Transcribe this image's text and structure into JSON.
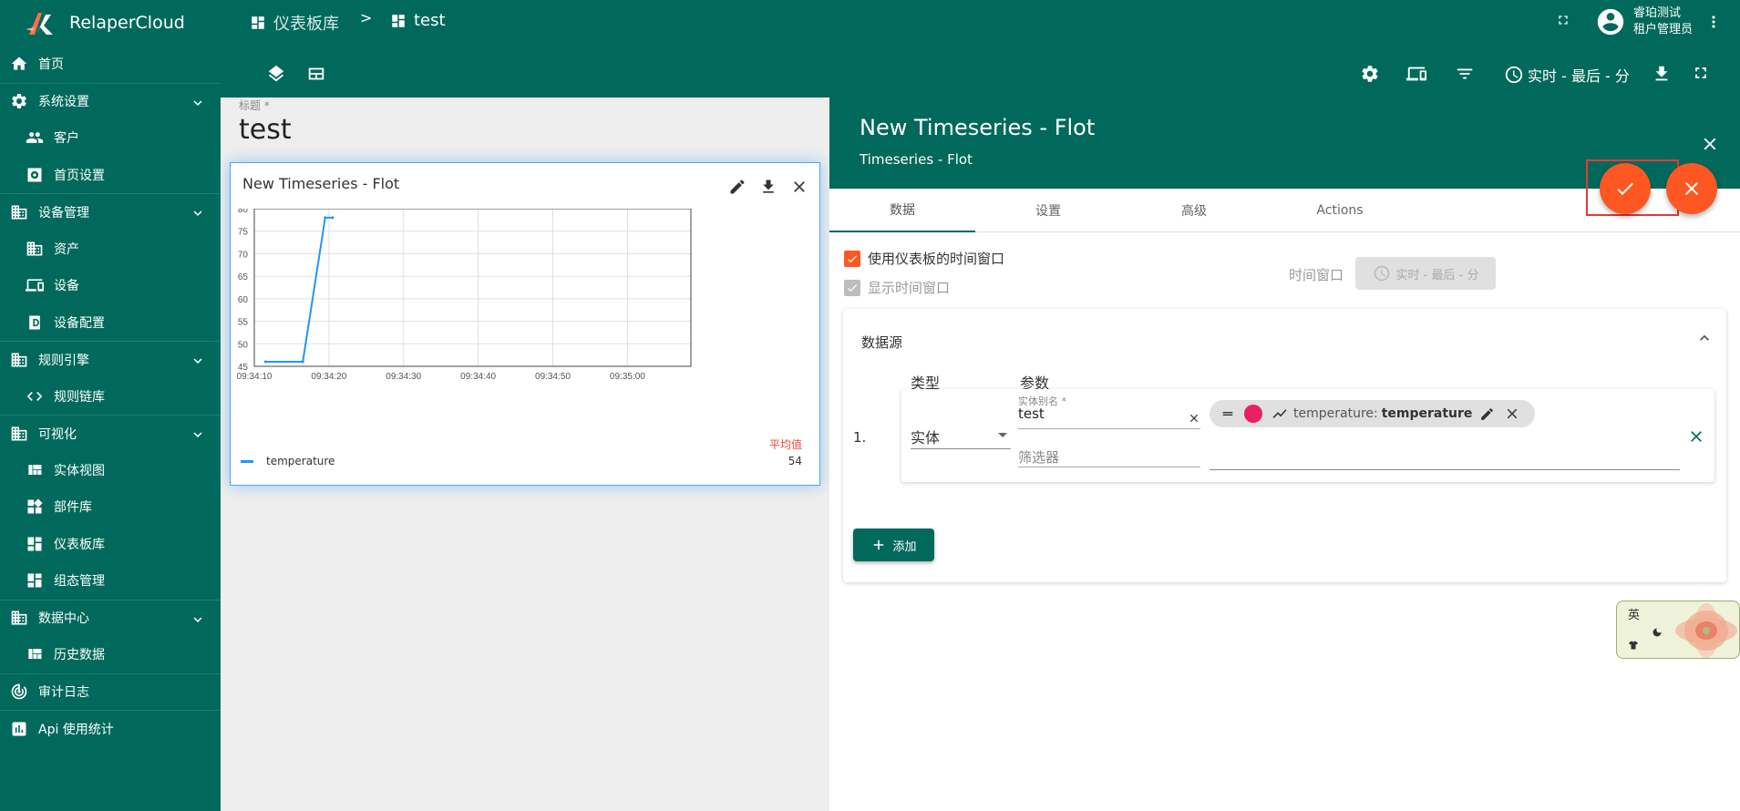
{
  "sidebar": {
    "brand": "RelaperCloud",
    "items": [
      {
        "label": "首页",
        "icon": "home-icon"
      },
      {
        "label": "系统设置",
        "icon": "gear-icon"
      },
      {
        "label": "客户",
        "icon": "people-icon"
      },
      {
        "label": "首页设置",
        "icon": "home-settings-icon"
      },
      {
        "label": "设备管理",
        "icon": "domain-icon"
      },
      {
        "label": "资产",
        "icon": "domain-icon"
      },
      {
        "label": "设备",
        "icon": "devices-icon"
      },
      {
        "label": "设备配置",
        "icon": "device-profile-icon"
      },
      {
        "label": "规则引擎",
        "icon": "domain-icon"
      },
      {
        "label": "规则链库",
        "icon": "code-icon"
      },
      {
        "label": "可视化",
        "icon": "domain-icon"
      },
      {
        "label": "实体视图",
        "icon": "view-quilt-icon"
      },
      {
        "label": "部件库",
        "icon": "widgets-icon"
      },
      {
        "label": "仪表板库",
        "icon": "dashboard-icon"
      },
      {
        "label": "组态管理",
        "icon": "dashboard-icon"
      },
      {
        "label": "数据中心",
        "icon": "domain-icon"
      },
      {
        "label": "历史数据",
        "icon": "view-quilt-icon"
      },
      {
        "label": "审计日志",
        "icon": "track-changes-icon"
      },
      {
        "label": "Api 使用统计",
        "icon": "insert-chart-icon"
      }
    ]
  },
  "header": {
    "breadcrumb_root": "仪表板库",
    "breadcrumb_sep": ">",
    "breadcrumb_current": "test",
    "user_name": "睿珀测试",
    "user_role": "租户管理员",
    "timewindow_label": "实时 - 最后 - 分"
  },
  "dashboard": {
    "title_label": "标题 *",
    "title_value": "test"
  },
  "widget": {
    "title": "New Timeseries - Flot",
    "legend_header": "平均值",
    "legend_series": "temperature",
    "legend_avg": "54"
  },
  "chart_data": {
    "type": "line",
    "title": "",
    "xlabel": "",
    "ylabel": "",
    "ylim": [
      45,
      80
    ],
    "yticks": [
      "80",
      "75",
      "70",
      "65",
      "60",
      "55",
      "50",
      "45"
    ],
    "xticks": [
      "09:34:10",
      "09:34:20",
      "09:34:30",
      "09:34:40",
      "09:34:50",
      "09:35:00"
    ],
    "series": [
      {
        "name": "temperature",
        "color": "#2196f3",
        "x": [
          "09:34:11.5",
          "09:34:16.5",
          "09:34:19.5",
          "09:34:20.5"
        ],
        "values": [
          46,
          46,
          78,
          78
        ]
      }
    ]
  },
  "panel": {
    "title": "New Timeseries - Flot",
    "subtitle": "Timeseries - Flot",
    "tabs": [
      "数据",
      "设置",
      "高级",
      "Actions"
    ],
    "use_dashboard_timewindow": "使用仪表板的时间窗口",
    "show_timewindow": "显示时间窗口",
    "timewindow_label": "时间窗口",
    "timewindow_value": "实时 - 最后 - 分",
    "datasources_title": "数据源",
    "col_type": "类型",
    "col_params": "参数",
    "row_index": "1.",
    "type_value": "实体",
    "alias_label": "实体别名 *",
    "alias_value": "test",
    "filter_placeholder": "筛选器",
    "chip_key": "temperature:",
    "chip_label": "temperature",
    "add_label": "添加",
    "ime_char": "英"
  },
  "colors": {
    "primary": "#00695c",
    "accent": "#ff5722",
    "chip_dot": "#e91e63",
    "series": "#2196f3"
  }
}
